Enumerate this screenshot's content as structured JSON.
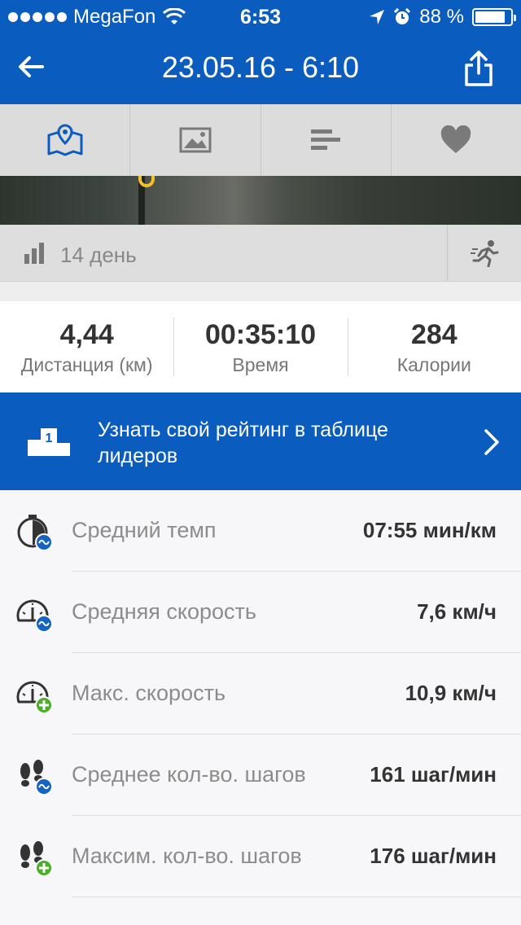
{
  "status_bar": {
    "carrier": "MegaFon",
    "time": "6:53",
    "battery_percent": "88 %",
    "battery_level": 0.88
  },
  "header": {
    "title": "23.05.16 - 6:10",
    "back_icon": "arrow-left-icon",
    "share_icon": "share-icon"
  },
  "tabs": [
    {
      "icon": "map-icon",
      "active": true
    },
    {
      "icon": "image-icon",
      "active": false
    },
    {
      "icon": "bar-chart-icon",
      "active": false
    },
    {
      "icon": "heart-icon",
      "active": false
    }
  ],
  "graph_row": {
    "label": "14 день"
  },
  "stats": [
    {
      "value": "4,44",
      "caption": "Дистанция (км)"
    },
    {
      "value": "00:35:10",
      "caption": "Время"
    },
    {
      "value": "284",
      "caption": "Калории"
    }
  ],
  "banner": {
    "text": "Узнать свой рейтинг в таблице лидеров",
    "podium_number": "1"
  },
  "metrics": [
    {
      "name": "Средний темп",
      "value": "07:55 мин/км",
      "icon": "stopwatch-average-icon"
    },
    {
      "name": "Средняя скорость",
      "value": "7,6 км/ч",
      "icon": "speedometer-average-icon"
    },
    {
      "name": "Макс. скорость",
      "value": "10,9 км/ч",
      "icon": "speedometer-max-icon"
    },
    {
      "name": "Среднее кол-во. шагов",
      "value": "161 шаг/мин",
      "icon": "footsteps-average-icon"
    },
    {
      "name": "Максим. кол-во. шагов",
      "value": "176 шаг/мин",
      "icon": "footsteps-max-icon"
    }
  ],
  "colors": {
    "brand_blue": "#0b5cbf",
    "badge_blue": "#1565c0",
    "badge_green": "#4caf2a",
    "active_tab_icon": "#0b5cbf",
    "inactive_tab_icon": "#7a7a7a"
  }
}
